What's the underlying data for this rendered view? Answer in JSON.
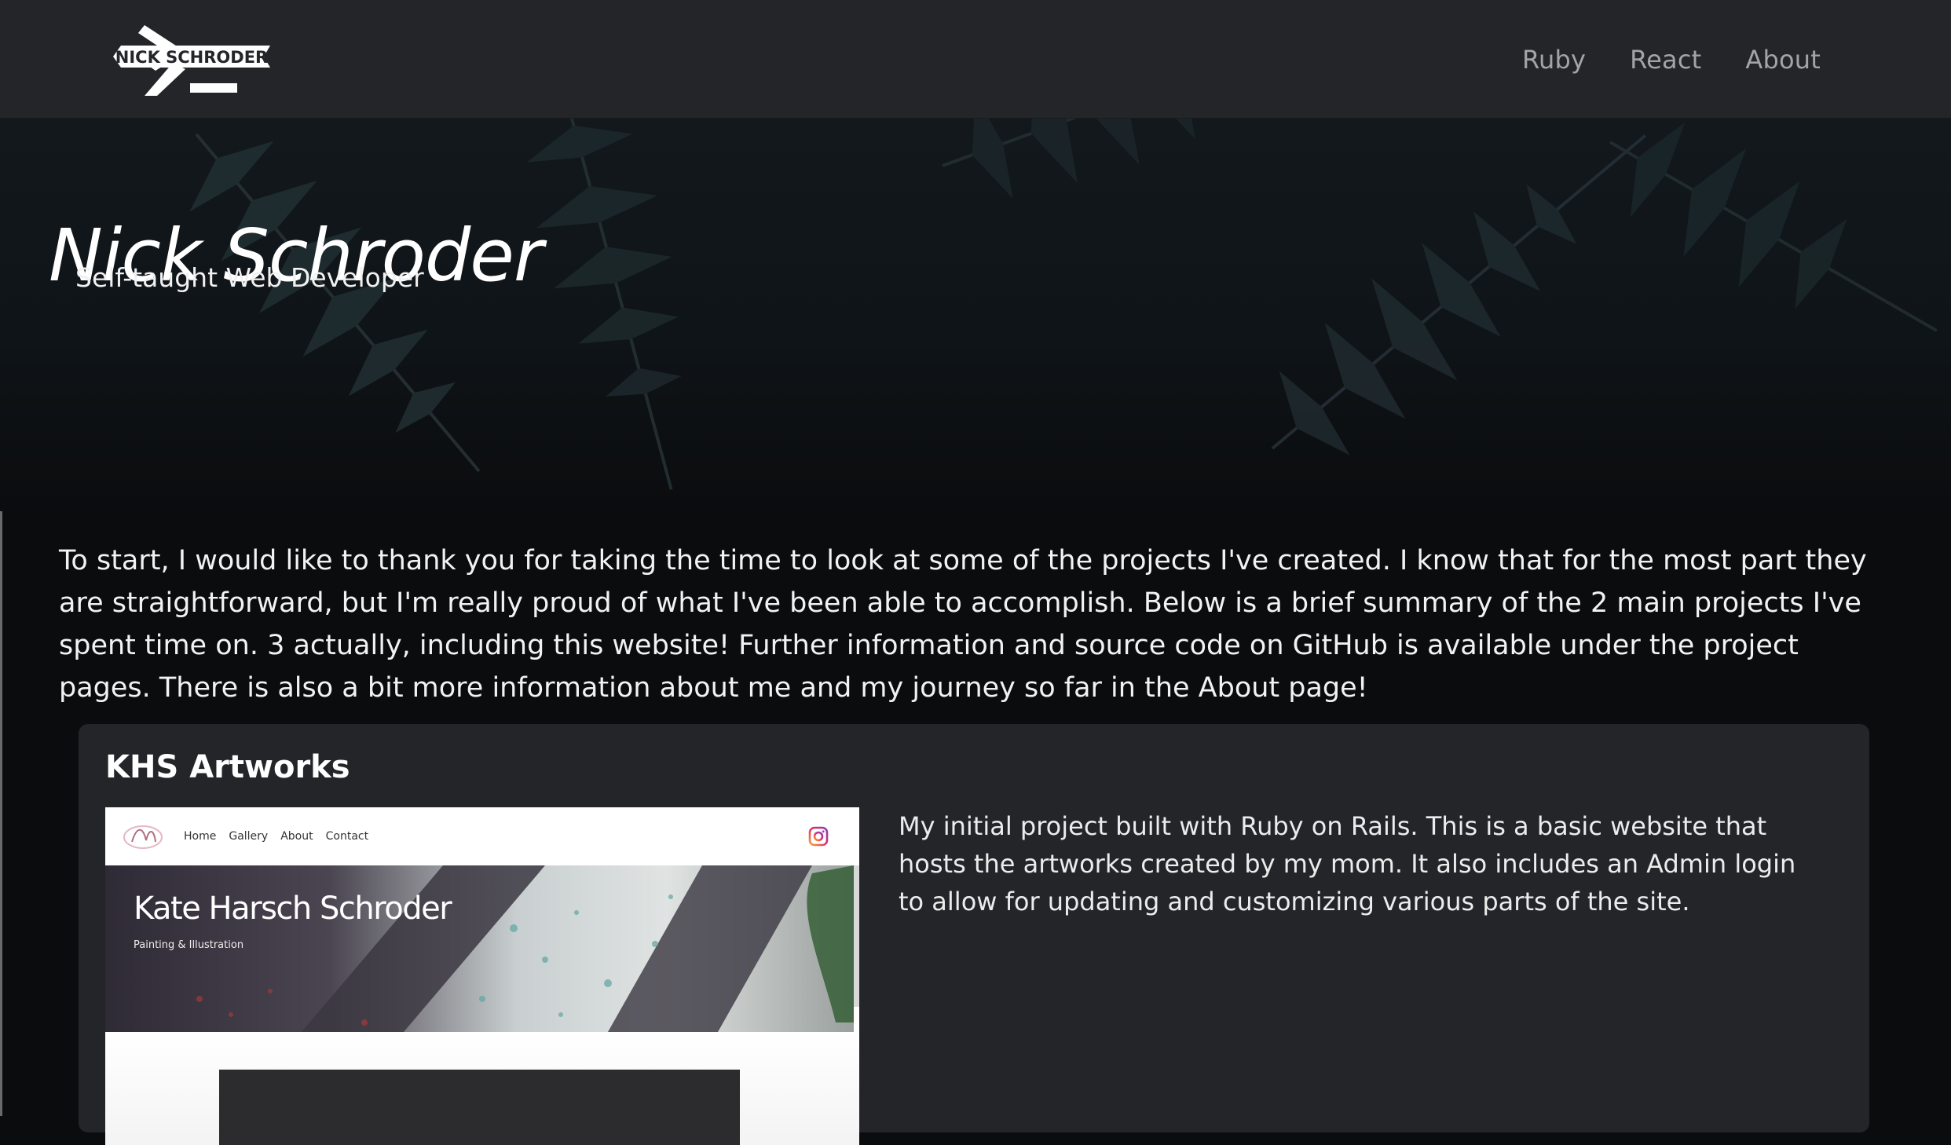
{
  "nav": {
    "logo_text": "NICK SCHRODER",
    "links": [
      {
        "label": "Ruby"
      },
      {
        "label": "React"
      },
      {
        "label": "About"
      }
    ]
  },
  "hero": {
    "title": "Nick Schroder",
    "subtitle": "Self-taught Web Developer"
  },
  "intro": {
    "text": "To start, I would like to thank you for taking the time to look at some of the projects I've created. I know that for the most part they are straightforward, but I'm really proud of what I've been able to accomplish. Below is a brief summary of the 2 main projects I've spent time on. 3 actually, including this website! Further information and source code on GitHub is available under the project pages. There is also a bit more information about me and my journey so far in the About page!"
  },
  "project": {
    "title": "KHS Artworks",
    "description": "My initial project built with Ruby on Rails. This is a basic website that hosts the artworks created by my mom. It also includes an Admin login to allow for updating and customizing various parts of the site.",
    "preview": {
      "nav_links": [
        "Home",
        "Gallery",
        "About",
        "Contact"
      ],
      "title": "Kate Harsch Schroder",
      "subtitle": "Painting & Illustration"
    }
  },
  "colors": {
    "navbar_bg": "#232529",
    "nav_link": "#a2a4a7",
    "page_bg": "#0b0c0e",
    "card_bg": "#232529"
  }
}
